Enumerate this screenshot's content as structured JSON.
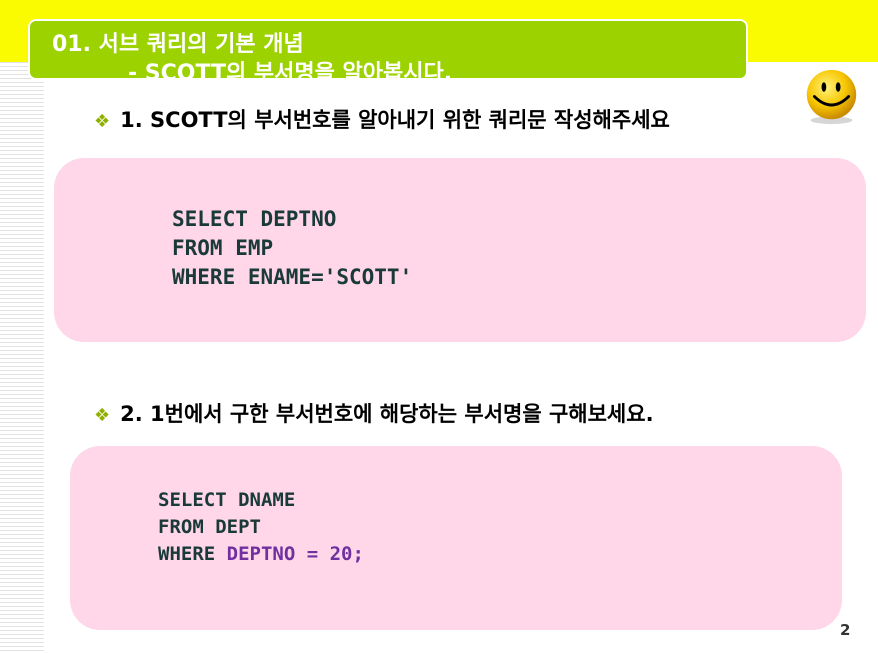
{
  "header": {
    "title": "01. 서브 쿼리의 기본 개념",
    "subtitle": "- SCOTT의 부서명을 알아봅시다."
  },
  "icons": {
    "bullet": "diamond-bullet-icon",
    "decoration": "smiley-face-icon"
  },
  "colors": {
    "top_band": "#fafa00",
    "title_box": "#9cd200",
    "code_box": "#ffd7e8",
    "code_text": "#1a3a3a",
    "highlight": "#7030a0"
  },
  "question1": {
    "bullet": "❖",
    "text": "1. SCOTT의 부서번호를 알아내기 위한 쿼리문 작성해주세요",
    "code": {
      "line1": "SELECT DEPTNO",
      "line2": "FROM EMP",
      "line3": "WHERE ENAME='SCOTT'"
    }
  },
  "question2": {
    "bullet": "❖",
    "text": "2. 1번에서 구한 부서번호에 해당하는 부서명을 구해보세요.",
    "code": {
      "line1": "SELECT DNAME",
      "line2": "FROM DEPT",
      "line3_keyword": "WHERE ",
      "line3_highlight": "DEPTNO = 20;"
    }
  },
  "page_number": "2"
}
